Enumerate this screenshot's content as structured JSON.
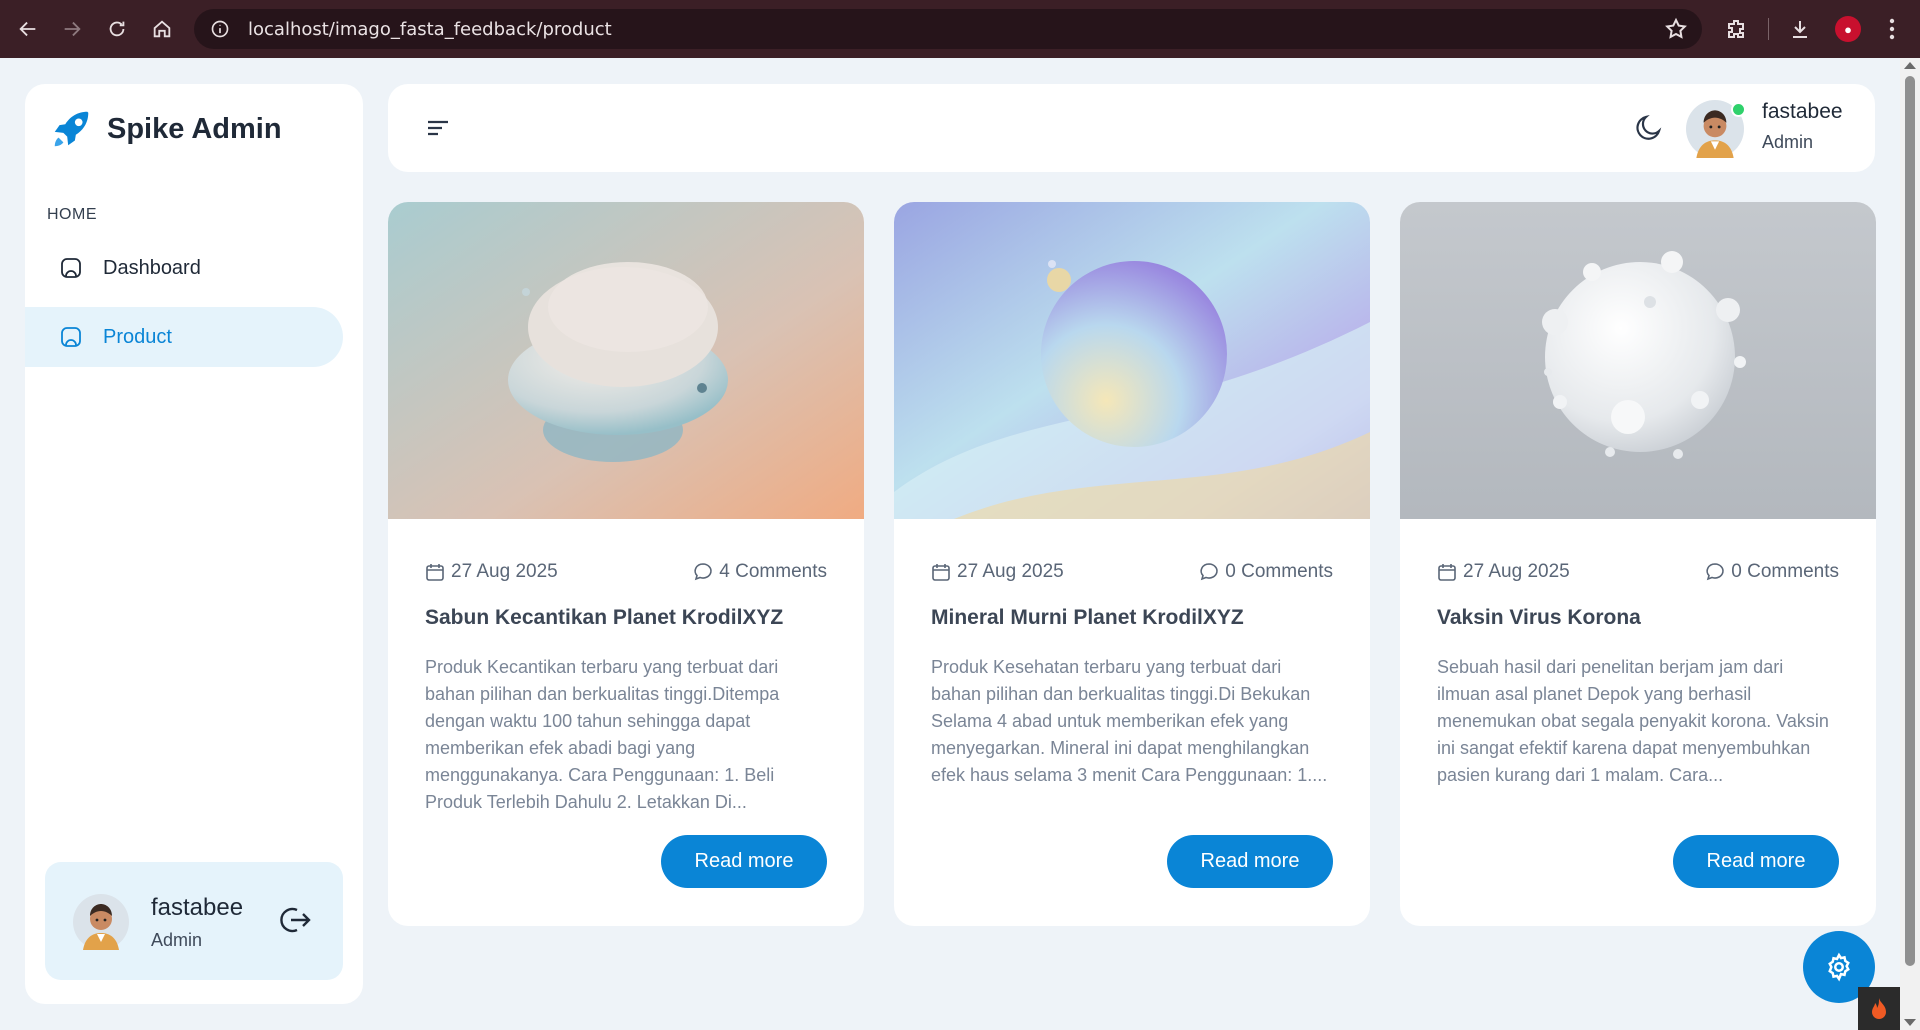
{
  "browser": {
    "url": "localhost/imago_fasta_feedback/product"
  },
  "sidebar": {
    "brand": "Spike Admin",
    "section_heading": "HOME",
    "items": [
      {
        "label": "Dashboard",
        "icon": "screen-icon",
        "active": false
      },
      {
        "label": "Product",
        "icon": "screen-icon",
        "active": true
      }
    ],
    "user": {
      "name": "fastabee",
      "role": "Admin"
    }
  },
  "header": {
    "user": {
      "name": "fastabee",
      "role": "Admin",
      "status": "online"
    }
  },
  "products": [
    {
      "date": "27 Aug 2025",
      "comments": "4 Comments",
      "title": "Sabun Kecantikan Planet KrodilXYZ",
      "description": "Produk Kecantikan terbaru yang terbuat dari bahan pilihan dan berkualitas tinggi.Ditempa dengan waktu 100 tahun sehingga dapat memberikan efek abadi bagi yang menggunakanya. Cara Penggunaan: 1. Beli Produk Terlebih Dahulu 2. Letakkan Di...",
      "button": "Read more"
    },
    {
      "date": "27 Aug 2025",
      "comments": "0 Comments",
      "title": "Mineral Murni Planet KrodilXYZ",
      "description": "Produk Kesehatan terbaru yang terbuat dari bahan pilihan dan berkualitas tinggi.Di Bekukan Selama 4 abad untuk memberikan efek yang menyegarkan. Mineral ini dapat menghilangkan efek haus selama 3 menit Cara Penggunaan: 1....",
      "button": "Read more"
    },
    {
      "date": "27 Aug 2025",
      "comments": "0 Comments",
      "title": "Vaksin Virus Korona",
      "description": "Sebuah hasil dari penelitan berjam jam dari ilmuan asal planet Depok yang berhasil menemukan obat segala penyakit korona. Vaksin ini sangat efektif karena dapat menyembuhkan pasien kurang dari 1 malam. Cara...",
      "button": "Read more"
    }
  ],
  "colors": {
    "primary": "#0a85d6",
    "active_bg": "#e5f3fb",
    "page_bg": "#eef3f8",
    "browser_bar": "#3b1f26",
    "online": "#2fd16b"
  }
}
